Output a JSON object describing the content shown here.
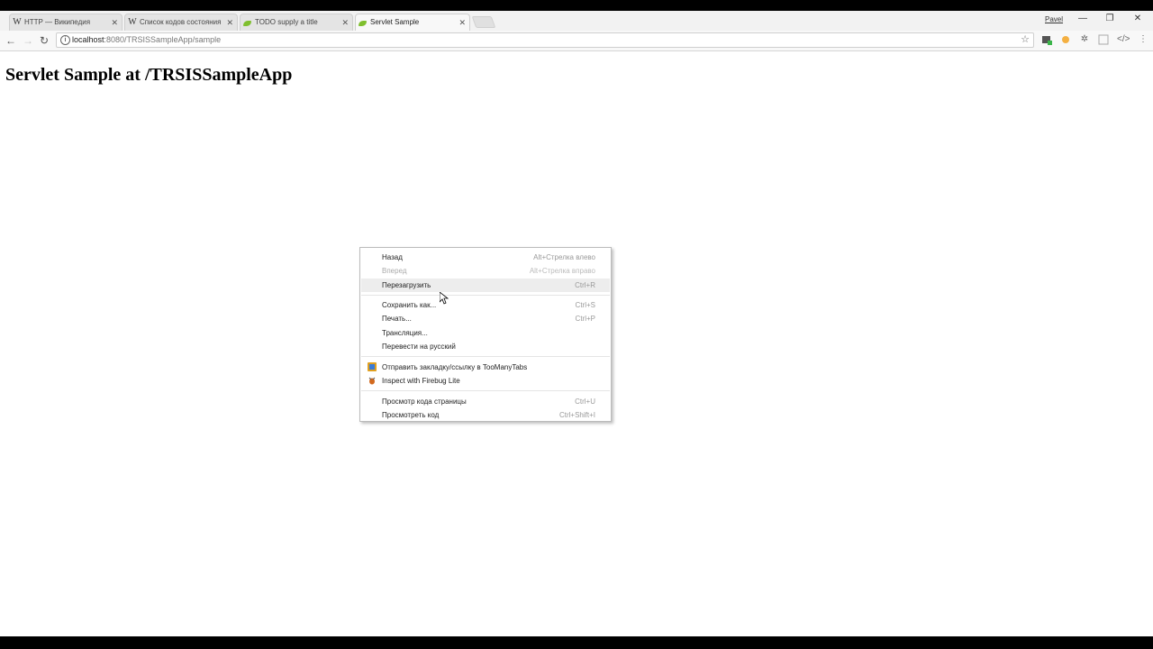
{
  "tabs": [
    {
      "title": "HTTP — Википедия",
      "favicon": "wikipedia-icon"
    },
    {
      "title": "Список кодов состояния",
      "favicon": "wikipedia-icon"
    },
    {
      "title": "TODO supply a title",
      "favicon": "leaf-icon"
    },
    {
      "title": "Servlet Sample",
      "favicon": "leaf-icon",
      "active": true
    }
  ],
  "window": {
    "profile": "Pavel"
  },
  "toolbar": {
    "url_host": "localhost",
    "url_rest": ":8080/TRSISSampleApp/sample"
  },
  "page": {
    "heading": "Servlet Sample at /TRSISSampleApp"
  },
  "context_menu": {
    "back": {
      "label": "Назад",
      "shortcut": "Alt+Стрелка влево"
    },
    "forward": {
      "label": "Вперед",
      "shortcut": "Alt+Стрелка вправо"
    },
    "reload": {
      "label": "Перезагрузить",
      "shortcut": "Ctrl+R"
    },
    "save_as": {
      "label": "Сохранить как...",
      "shortcut": "Ctrl+S"
    },
    "print": {
      "label": "Печать...",
      "shortcut": "Ctrl+P"
    },
    "cast": {
      "label": "Трансляция..."
    },
    "translate": {
      "label": "Перевести на русский"
    },
    "toomanytabs": {
      "label": "Отправить закладку/ссылку в TooManyTabs",
      "icon": "toomanytabs-icon"
    },
    "firebug": {
      "label": "Inspect with Firebug Lite",
      "icon": "firebug-icon"
    },
    "view_source": {
      "label": "Просмотр кода страницы",
      "shortcut": "Ctrl+U"
    },
    "inspect": {
      "label": "Просмотреть код",
      "shortcut": "Ctrl+Shift+I"
    }
  },
  "colors": {
    "accent_leaf": "#7fbf2e",
    "menu_hover": "#ededed"
  }
}
